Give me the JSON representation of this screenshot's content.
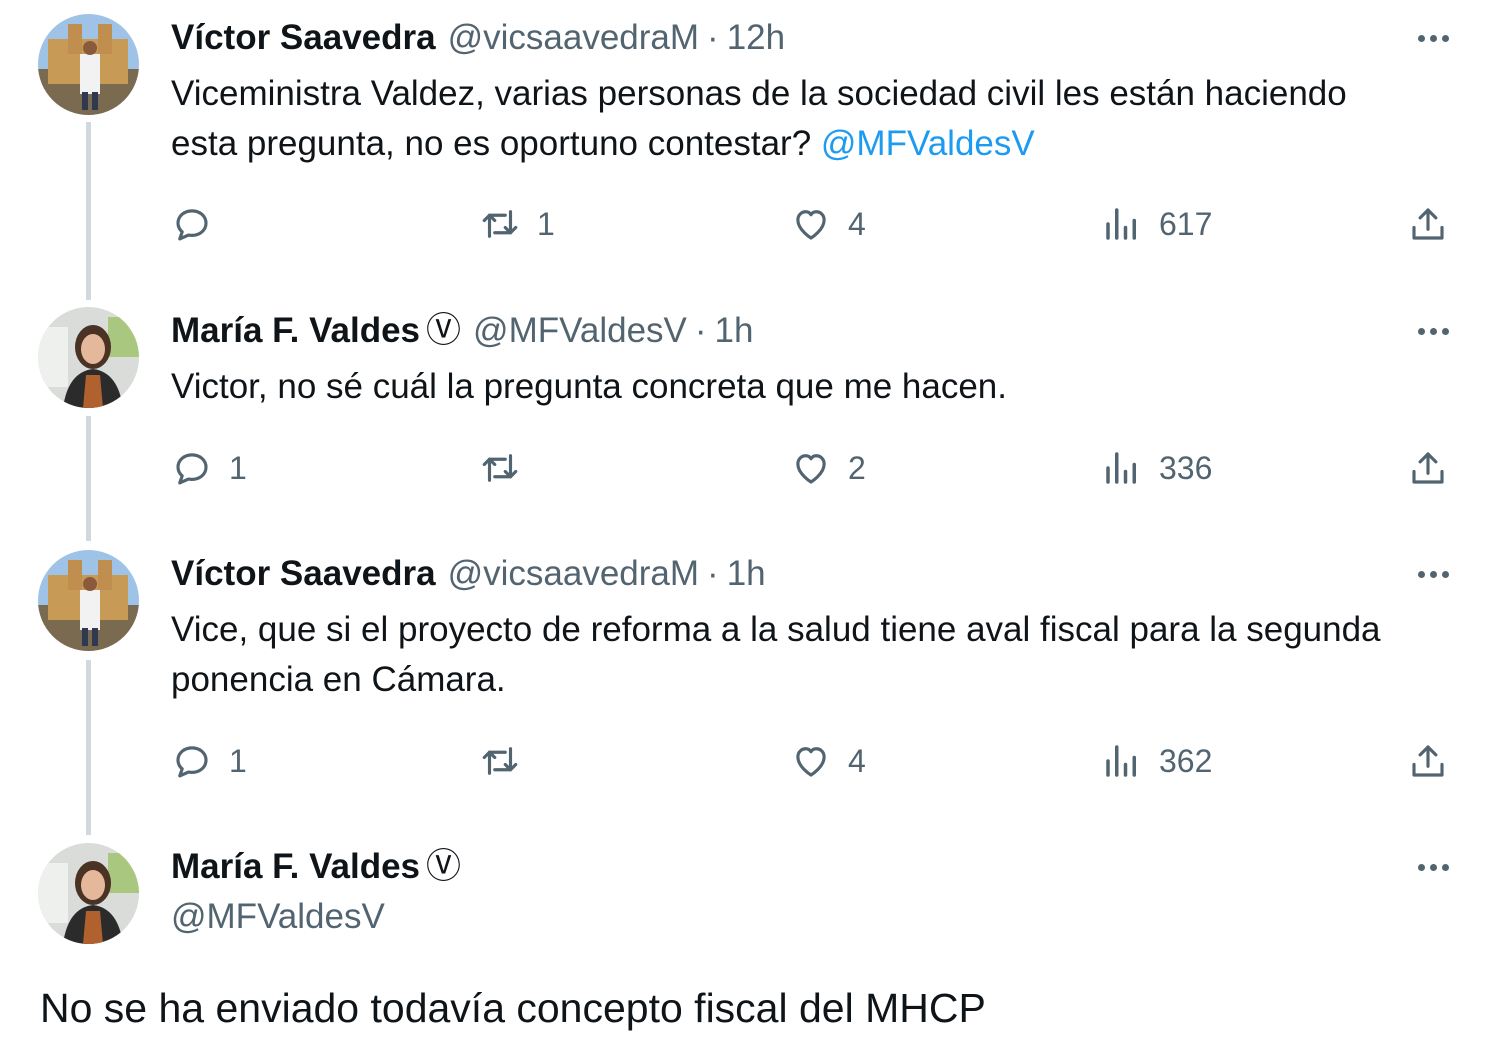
{
  "tweets": [
    {
      "name": "Víctor Saavedra",
      "handle": "@vicsaavedraM",
      "dot": "·",
      "time": "12h",
      "text": "Viceministra Valdez, varias personas de la sociedad civil les están haciendo esta pregunta, no es oportuno contestar?",
      "mention": "@MFValdesV",
      "replies": "",
      "retweets": "1",
      "likes": "4",
      "views": "617"
    },
    {
      "name": "María F. Valdes",
      "verified": "Ⓥ",
      "handle": "@MFValdesV",
      "dot": "·",
      "time": "1h",
      "text": "Victor, no sé cuál la pregunta concreta que me hacen.",
      "replies": "1",
      "retweets": "",
      "likes": "2",
      "views": "336"
    },
    {
      "name": "Víctor Saavedra",
      "handle": "@vicsaavedraM",
      "dot": "·",
      "time": "1h",
      "text": "Vice, que si el proyecto de reforma a la salud tiene aval fiscal para la segunda ponencia en Cámara.",
      "replies": "1",
      "retweets": "",
      "likes": "4",
      "views": "362"
    }
  ],
  "main_tweet": {
    "name": "María F. Valdes",
    "verified": "Ⓥ",
    "handle": "@MFValdesV",
    "text": "No se ha enviado todavía concepto fiscal del MHCP"
  },
  "icons": {
    "reply": "reply-icon",
    "retweet": "retweet-icon",
    "like": "heart-icon",
    "views": "views-icon",
    "share": "share-icon",
    "more": "more-icon"
  },
  "colors": {
    "text": "#0f1419",
    "secondary": "#536471",
    "link": "#1d9bf0",
    "thread_line": "#cfd9de"
  }
}
